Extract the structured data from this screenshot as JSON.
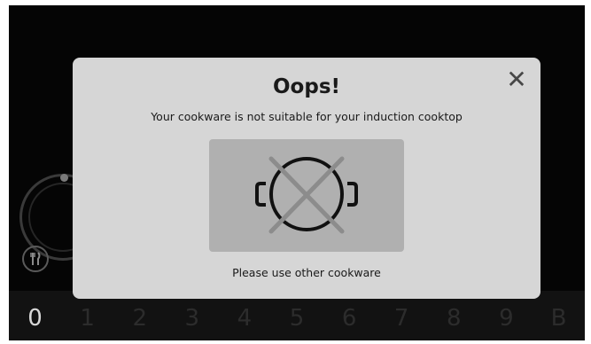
{
  "dialog": {
    "title": "Oops!",
    "message": "Your cookware is not suitable for your induction cooktop",
    "hint": "Please use other cookware",
    "close_icon": "close-icon",
    "close_glyph": "✕",
    "illustration_icon": "unsuitable-cookware-icon"
  },
  "cooktop": {
    "cutlery_icon": "cutlery-icon",
    "power_levels": [
      "0",
      "1",
      "2",
      "3",
      "4",
      "5",
      "6",
      "7",
      "8",
      "9",
      "B"
    ],
    "active_level": "0"
  },
  "colors": {
    "background": "#050505",
    "dialog": "#d6d6d6",
    "illustration_bg": "#b0b0b0",
    "cross": "#8c8c8c",
    "pot": "#111111"
  }
}
